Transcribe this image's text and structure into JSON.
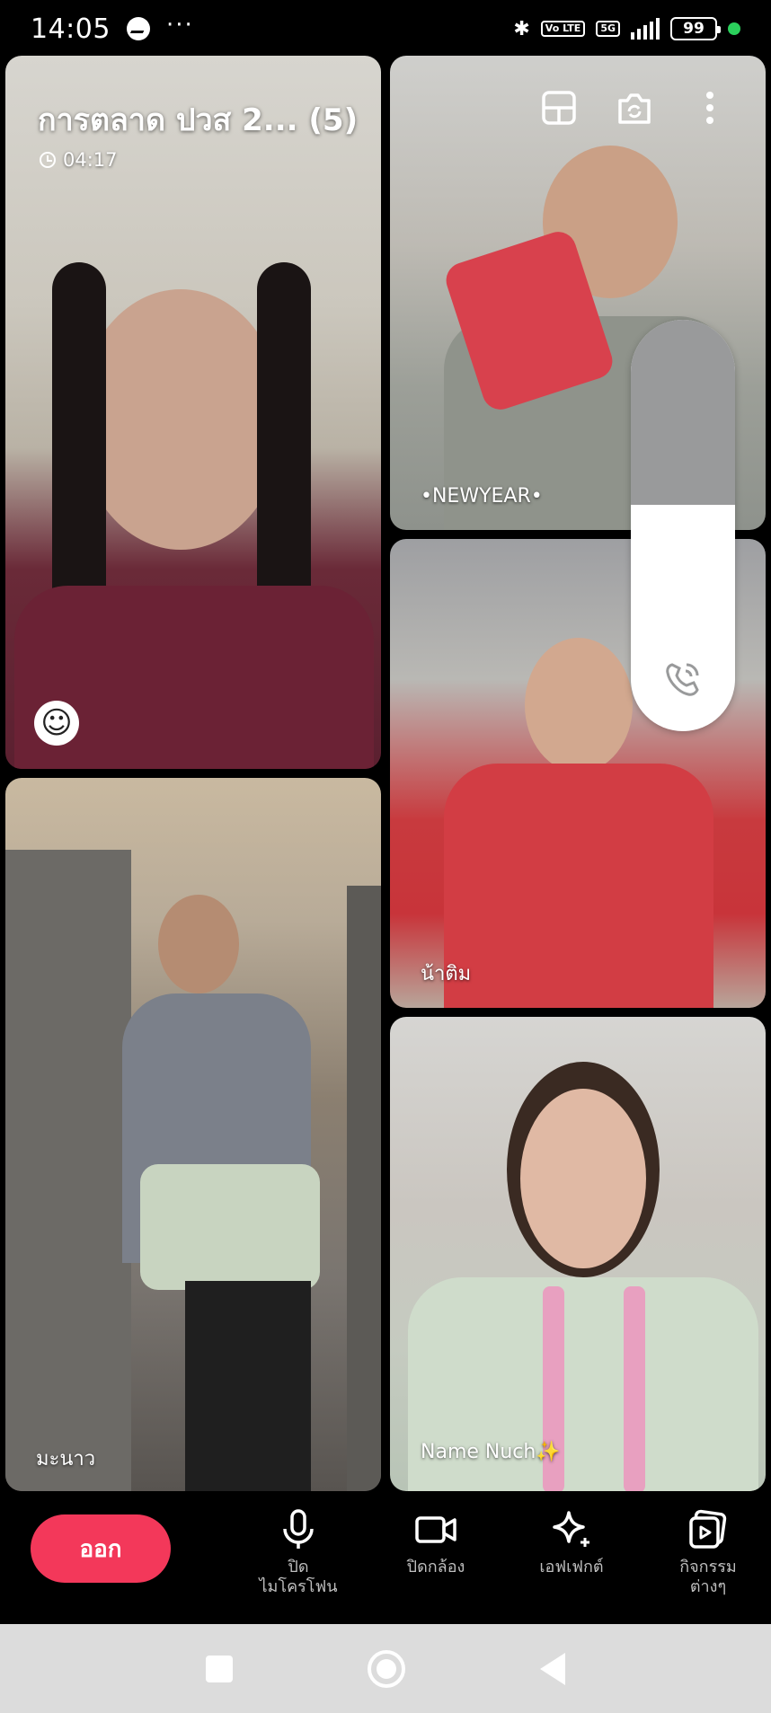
{
  "status_bar": {
    "time": "14:05",
    "dots": "···",
    "volte_badge": "Vo LTE",
    "network": "5G",
    "battery": "99"
  },
  "call": {
    "title": "การตลาด ปวส 2... (5)",
    "timer": "04:17"
  },
  "participants": [
    {
      "name": "",
      "tile": "self"
    },
    {
      "name": "•NEWYEAR•"
    },
    {
      "name": "น้าติม"
    },
    {
      "name": "มะนาว"
    },
    {
      "name": "Name Nuch✨"
    }
  ],
  "overlay": {
    "volume_level": 0.55
  },
  "controls": {
    "leave_label": "ออก",
    "mic_label": "ปิด\nไมโครโฟน",
    "camera_label": "ปิดกล้อง",
    "effects_label": "เอฟเฟกต์",
    "activities_label": "กิจกรรม\nต่างๆ"
  },
  "colors": {
    "leave": "#f3385a",
    "background": "#000000",
    "navbar": "#dcdcdc"
  }
}
